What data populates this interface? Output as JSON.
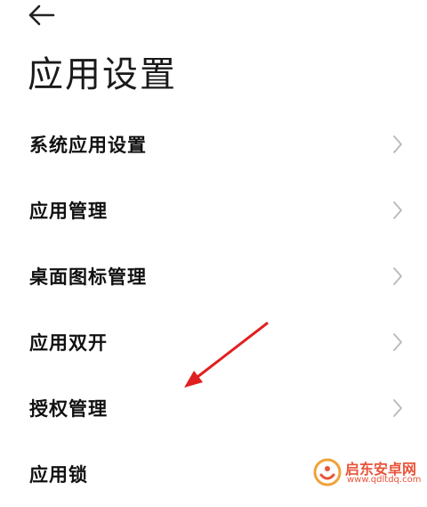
{
  "header": {
    "back_icon": "arrow-left-icon",
    "title": "应用设置"
  },
  "menu": {
    "items": [
      {
        "label": "系统应用设置"
      },
      {
        "label": "应用管理"
      },
      {
        "label": "桌面图标管理"
      },
      {
        "label": "应用双开"
      },
      {
        "label": "授权管理"
      },
      {
        "label": "应用锁"
      }
    ],
    "chevron_icon": "chevron-right-icon"
  },
  "annotation": {
    "arrow_color": "#e02020"
  },
  "watermark": {
    "title": "启东安卓网",
    "url": "www.qdltdq.com"
  }
}
